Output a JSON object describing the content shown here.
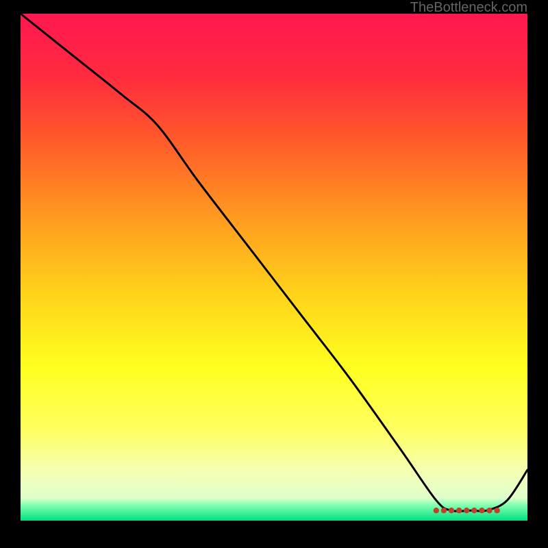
{
  "watermark": "TheBottleneck.com",
  "chart_data": {
    "type": "line",
    "title": "",
    "xlabel": "",
    "ylabel": "",
    "xlim": [
      0,
      100
    ],
    "ylim": [
      0,
      100
    ],
    "series": [
      {
        "name": "curve",
        "x": [
          0,
          10,
          20,
          27,
          35,
          45,
          55,
          65,
          75,
          82,
          85,
          89,
          92,
          96,
          100
        ],
        "y": [
          100,
          92,
          84,
          78,
          67,
          54,
          41,
          28,
          14,
          4,
          2,
          2,
          2,
          4,
          10
        ]
      }
    ],
    "highlight_band": {
      "x0": 82,
      "x1": 94,
      "y": 2
    },
    "gradient_stops": [
      {
        "pct": 0,
        "color": "#ff1850"
      },
      {
        "pct": 12,
        "color": "#ff2a3f"
      },
      {
        "pct": 25,
        "color": "#ff5a2a"
      },
      {
        "pct": 40,
        "color": "#ff9a20"
      },
      {
        "pct": 55,
        "color": "#ffd21a"
      },
      {
        "pct": 70,
        "color": "#ffff20"
      },
      {
        "pct": 82,
        "color": "#ffff60"
      },
      {
        "pct": 90,
        "color": "#f5ffb0"
      },
      {
        "pct": 95.5,
        "color": "#e0ffcc"
      },
      {
        "pct": 97,
        "color": "#80ffb0"
      },
      {
        "pct": 100,
        "color": "#00e080"
      }
    ]
  }
}
